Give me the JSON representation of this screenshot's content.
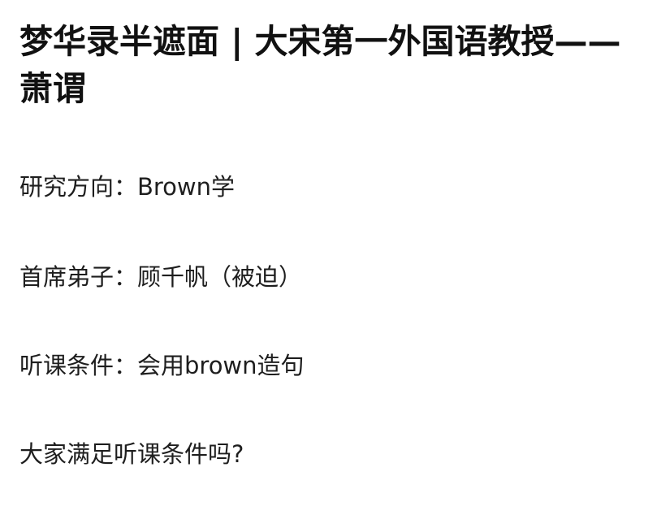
{
  "post": {
    "title": "梦华录半遮面 | 大宋第一外国语教授——萧谓",
    "lines": [
      "研究方向：Brown学",
      "首席弟子：顾千帆（被迫）",
      "听课条件：会用brown造句",
      "大家满足听课条件吗?"
    ]
  }
}
